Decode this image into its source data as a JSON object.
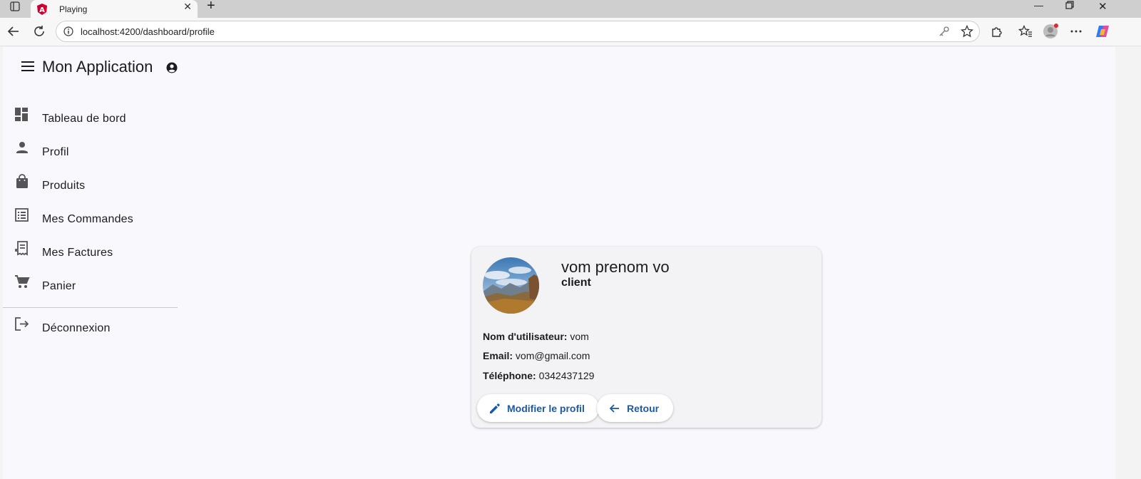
{
  "browser": {
    "tab_title": "Playing",
    "url": "localhost:4200/dashboard/profile",
    "icons": [
      "sidebar-toggle-icon",
      "angular-logo-icon",
      "close-icon",
      "plus-icon",
      "back-icon",
      "reload-icon",
      "info-icon",
      "key-icon",
      "star-icon",
      "extensions-icon",
      "favorites-icon",
      "profile-icon",
      "more-icon",
      "copilot-icon"
    ]
  },
  "app": {
    "title": "Mon Application"
  },
  "sidebar": {
    "items": [
      {
        "label": "Tableau de bord",
        "icon": "dashboard-icon"
      },
      {
        "label": "Profil",
        "icon": "person-icon"
      },
      {
        "label": "Produits",
        "icon": "shopping-bag-icon"
      },
      {
        "label": "Mes Commandes",
        "icon": "list-icon"
      },
      {
        "label": "Mes Factures",
        "icon": "receipt-icon"
      },
      {
        "label": "Panier",
        "icon": "cart-icon"
      }
    ],
    "logout": {
      "label": "Déconnexion",
      "icon": "logout-icon"
    }
  },
  "profile": {
    "name": "vom prenom vo",
    "role": "client",
    "username_label": "Nom d'utilisateur:",
    "username": "vom",
    "email_label": "Email:",
    "email": "vom@gmail.com",
    "phone_label": "Téléphone:",
    "phone": "0342437129",
    "edit_button": "Modifier le profil",
    "back_button": "Retour"
  },
  "colors": {
    "accent": "#1a5aa6",
    "app_bg": "#f9f8fd",
    "card_bg": "#f3f3f5"
  }
}
